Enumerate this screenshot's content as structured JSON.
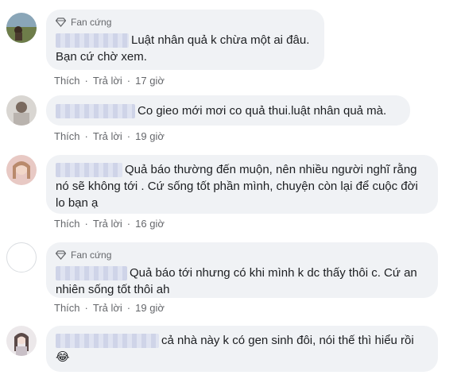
{
  "comments": [
    {
      "badge": "Fan cứng",
      "line1": "Luật nhân quả k chừa một ai đâu.",
      "line2": "Bạn cứ chờ xem.",
      "like": "Thích",
      "reply": "Trả lời",
      "time": "17 giờ"
    },
    {
      "line1": "Co gieo mới mơi co quả thui.luật nhân quả mà.",
      "like": "Thích",
      "reply": "Trả lời",
      "time": "19 giờ"
    },
    {
      "line1": "Quả báo thường đến muộn, nên nhiều người nghĩ rằng",
      "line2": "nó sẽ không tới . Cứ sống tốt phần mình, chuyện còn lại để cuộc đời",
      "line3": "lo bạn ạ",
      "like": "Thích",
      "reply": "Trả lời",
      "time": "16 giờ"
    },
    {
      "badge": "Fan cứng",
      "line1": "Quả báo tới nhưng có khi mình k dc thấy thôi c. Cứ an",
      "line2": "nhiên sống tốt thôi ah",
      "like": "Thích",
      "reply": "Trả lời",
      "time": "19 giờ"
    },
    {
      "line1": "cả nhà này k có gen sinh đôi, nói thế thì hiểu rồi",
      "emoji": "😂"
    }
  ],
  "colors": {
    "bubble": "#f0f2f5",
    "text": "#1c1e21",
    "meta": "#65676b"
  }
}
